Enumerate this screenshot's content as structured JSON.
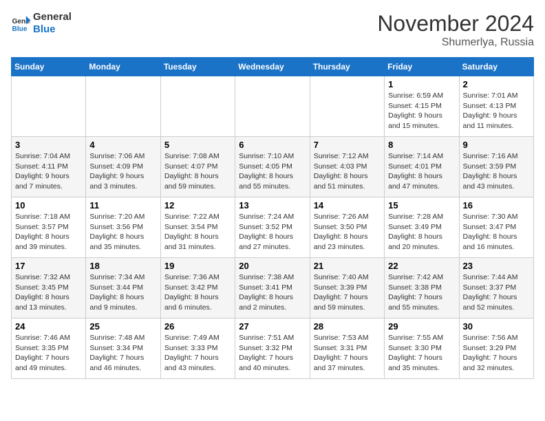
{
  "logo": {
    "line1": "General",
    "line2": "Blue"
  },
  "header": {
    "month": "November 2024",
    "location": "Shumerlya, Russia"
  },
  "weekdays": [
    "Sunday",
    "Monday",
    "Tuesday",
    "Wednesday",
    "Thursday",
    "Friday",
    "Saturday"
  ],
  "weeks": [
    [
      {
        "day": "",
        "info": ""
      },
      {
        "day": "",
        "info": ""
      },
      {
        "day": "",
        "info": ""
      },
      {
        "day": "",
        "info": ""
      },
      {
        "day": "",
        "info": ""
      },
      {
        "day": "1",
        "info": "Sunrise: 6:59 AM\nSunset: 4:15 PM\nDaylight: 9 hours and 15 minutes."
      },
      {
        "day": "2",
        "info": "Sunrise: 7:01 AM\nSunset: 4:13 PM\nDaylight: 9 hours and 11 minutes."
      }
    ],
    [
      {
        "day": "3",
        "info": "Sunrise: 7:04 AM\nSunset: 4:11 PM\nDaylight: 9 hours and 7 minutes."
      },
      {
        "day": "4",
        "info": "Sunrise: 7:06 AM\nSunset: 4:09 PM\nDaylight: 9 hours and 3 minutes."
      },
      {
        "day": "5",
        "info": "Sunrise: 7:08 AM\nSunset: 4:07 PM\nDaylight: 8 hours and 59 minutes."
      },
      {
        "day": "6",
        "info": "Sunrise: 7:10 AM\nSunset: 4:05 PM\nDaylight: 8 hours and 55 minutes."
      },
      {
        "day": "7",
        "info": "Sunrise: 7:12 AM\nSunset: 4:03 PM\nDaylight: 8 hours and 51 minutes."
      },
      {
        "day": "8",
        "info": "Sunrise: 7:14 AM\nSunset: 4:01 PM\nDaylight: 8 hours and 47 minutes."
      },
      {
        "day": "9",
        "info": "Sunrise: 7:16 AM\nSunset: 3:59 PM\nDaylight: 8 hours and 43 minutes."
      }
    ],
    [
      {
        "day": "10",
        "info": "Sunrise: 7:18 AM\nSunset: 3:57 PM\nDaylight: 8 hours and 39 minutes."
      },
      {
        "day": "11",
        "info": "Sunrise: 7:20 AM\nSunset: 3:56 PM\nDaylight: 8 hours and 35 minutes."
      },
      {
        "day": "12",
        "info": "Sunrise: 7:22 AM\nSunset: 3:54 PM\nDaylight: 8 hours and 31 minutes."
      },
      {
        "day": "13",
        "info": "Sunrise: 7:24 AM\nSunset: 3:52 PM\nDaylight: 8 hours and 27 minutes."
      },
      {
        "day": "14",
        "info": "Sunrise: 7:26 AM\nSunset: 3:50 PM\nDaylight: 8 hours and 23 minutes."
      },
      {
        "day": "15",
        "info": "Sunrise: 7:28 AM\nSunset: 3:49 PM\nDaylight: 8 hours and 20 minutes."
      },
      {
        "day": "16",
        "info": "Sunrise: 7:30 AM\nSunset: 3:47 PM\nDaylight: 8 hours and 16 minutes."
      }
    ],
    [
      {
        "day": "17",
        "info": "Sunrise: 7:32 AM\nSunset: 3:45 PM\nDaylight: 8 hours and 13 minutes."
      },
      {
        "day": "18",
        "info": "Sunrise: 7:34 AM\nSunset: 3:44 PM\nDaylight: 8 hours and 9 minutes."
      },
      {
        "day": "19",
        "info": "Sunrise: 7:36 AM\nSunset: 3:42 PM\nDaylight: 8 hours and 6 minutes."
      },
      {
        "day": "20",
        "info": "Sunrise: 7:38 AM\nSunset: 3:41 PM\nDaylight: 8 hours and 2 minutes."
      },
      {
        "day": "21",
        "info": "Sunrise: 7:40 AM\nSunset: 3:39 PM\nDaylight: 7 hours and 59 minutes."
      },
      {
        "day": "22",
        "info": "Sunrise: 7:42 AM\nSunset: 3:38 PM\nDaylight: 7 hours and 55 minutes."
      },
      {
        "day": "23",
        "info": "Sunrise: 7:44 AM\nSunset: 3:37 PM\nDaylight: 7 hours and 52 minutes."
      }
    ],
    [
      {
        "day": "24",
        "info": "Sunrise: 7:46 AM\nSunset: 3:35 PM\nDaylight: 7 hours and 49 minutes."
      },
      {
        "day": "25",
        "info": "Sunrise: 7:48 AM\nSunset: 3:34 PM\nDaylight: 7 hours and 46 minutes."
      },
      {
        "day": "26",
        "info": "Sunrise: 7:49 AM\nSunset: 3:33 PM\nDaylight: 7 hours and 43 minutes."
      },
      {
        "day": "27",
        "info": "Sunrise: 7:51 AM\nSunset: 3:32 PM\nDaylight: 7 hours and 40 minutes."
      },
      {
        "day": "28",
        "info": "Sunrise: 7:53 AM\nSunset: 3:31 PM\nDaylight: 7 hours and 37 minutes."
      },
      {
        "day": "29",
        "info": "Sunrise: 7:55 AM\nSunset: 3:30 PM\nDaylight: 7 hours and 35 minutes."
      },
      {
        "day": "30",
        "info": "Sunrise: 7:56 AM\nSunset: 3:29 PM\nDaylight: 7 hours and 32 minutes."
      }
    ]
  ]
}
